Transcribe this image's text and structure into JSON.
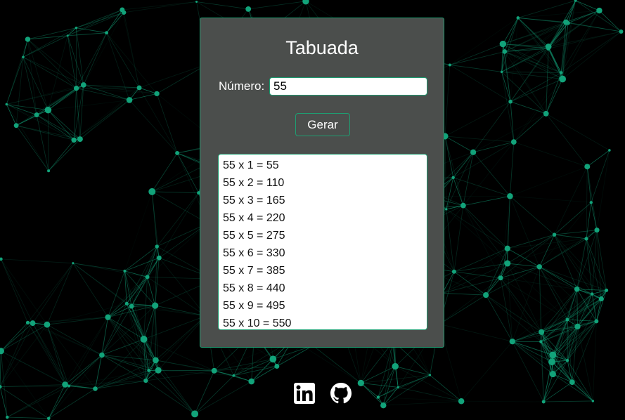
{
  "app": {
    "title": "Tabuada",
    "number_label": "Número:",
    "number_value": "55",
    "generate_label": "Gerar",
    "results": [
      "55 x 1 = 55",
      "55 x 2 = 110",
      "55 x 3 = 165",
      "55 x 4 = 220",
      "55 x 5 = 275",
      "55 x 6 = 330",
      "55 x 7 = 385",
      "55 x 8 = 440",
      "55 x 9 = 495",
      "55 x 10 = 550"
    ]
  },
  "footer": {
    "icons": [
      "linkedin-icon",
      "github-icon"
    ]
  },
  "colors": {
    "background": "#000000",
    "card": "#4b4e4c",
    "accent": "#1e9e72",
    "network": "#12a37a"
  }
}
